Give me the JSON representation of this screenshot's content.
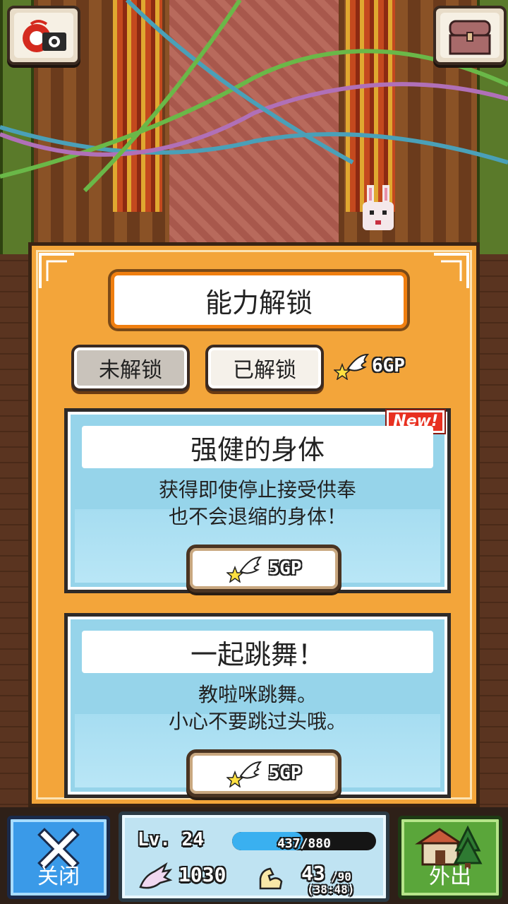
{
  "header": {
    "camera_icon": "camera-icon",
    "chest_icon": "treasure-chest-icon"
  },
  "panel": {
    "title": "能力解锁",
    "tabs": [
      {
        "label": "未解锁",
        "active": true
      },
      {
        "label": "已解锁",
        "active": false
      }
    ],
    "gp_total": "6GP"
  },
  "abilities": [
    {
      "title": "强健的身体",
      "desc_line1": "获得即使停止接受供奉",
      "desc_line2": "也不会退缩的身体！",
      "price": "5GP",
      "badge": "New!"
    },
    {
      "title": "一起跳舞！",
      "desc_line1": "教啦咪跳舞。",
      "desc_line2": "小心不要跳过头哦。",
      "price": "5GP",
      "badge": ""
    }
  ],
  "bottom": {
    "close_label": "关闭",
    "go_label": "外出",
    "level": "Lv. 24",
    "xp_text": "437/880",
    "xp_fraction": 0.4966,
    "faith": "1030",
    "strength": "43",
    "strength_max": "/90",
    "timer": "(38:48)"
  },
  "colors": {
    "panel": "#f3a53a",
    "card": "#96d4ea",
    "close": "#3a9ae8",
    "go": "#5aa63a",
    "xp": "#3ab0f0"
  }
}
